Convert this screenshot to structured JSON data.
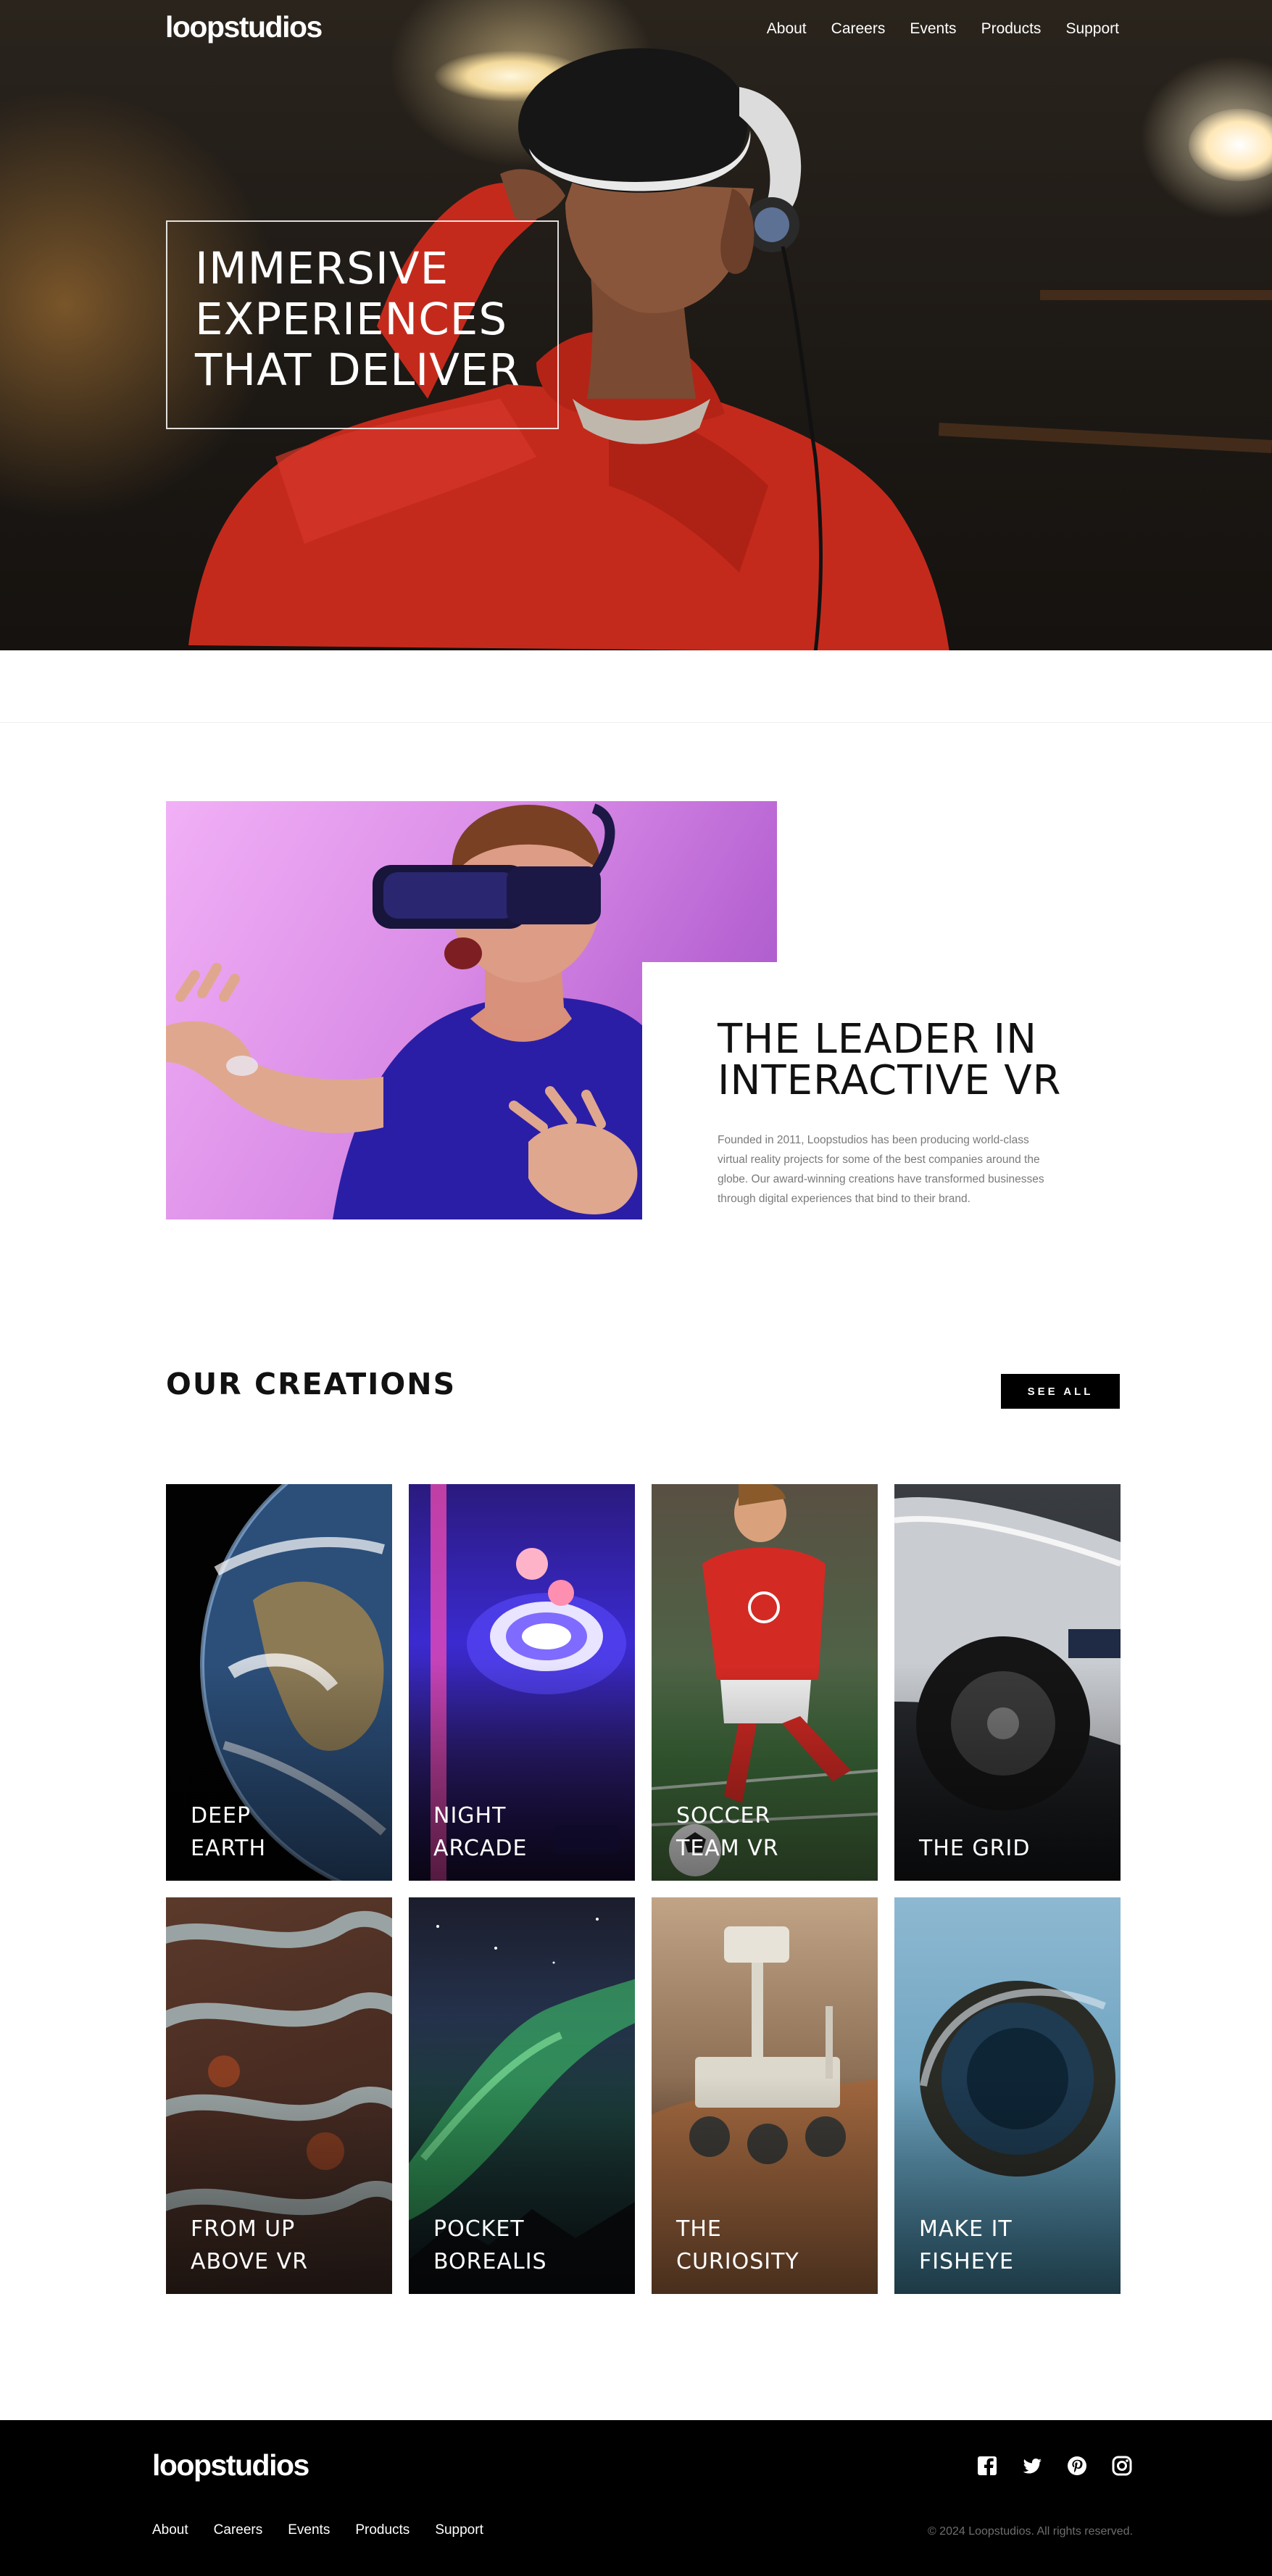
{
  "brand": {
    "logo_text": "loopstudios"
  },
  "header": {
    "nav": [
      "About",
      "Careers",
      "Events",
      "Products",
      "Support"
    ]
  },
  "hero": {
    "title": "IMMERSIVE\nEXPERIENCES\nTHAT DELIVER"
  },
  "leader": {
    "title": "THE LEADER IN\nINTERACTIVE VR",
    "text": "Founded in 2011, Loopstudios has been producing world-class virtual reality projects for some of the best companies around the globe. Our award-winning creations have transformed businesses through digital experiences that bind to their brand."
  },
  "creations": {
    "title": "OUR CREATIONS",
    "see_all_label": "SEE ALL",
    "items": [
      {
        "label": "DEEP\nEARTH"
      },
      {
        "label": "NIGHT\nARCADE"
      },
      {
        "label": "SOCCER\nTEAM VR"
      },
      {
        "label": "THE GRID"
      },
      {
        "label": "FROM UP\nABOVE VR"
      },
      {
        "label": "POCKET\nBOREALIS"
      },
      {
        "label": "THE\nCURIOSITY"
      },
      {
        "label": "MAKE IT\nFISHEYE"
      }
    ]
  },
  "footer": {
    "logo_text": "loopstudios",
    "nav": [
      "About",
      "Careers",
      "Events",
      "Products",
      "Support"
    ],
    "social_icons": [
      "facebook-icon",
      "twitter-icon",
      "pinterest-icon",
      "instagram-icon"
    ],
    "copyright": "© 2024 Loopstudios. All rights reserved."
  },
  "colors": {
    "footer_bg": "#000000",
    "button_bg": "#000000",
    "body_text_muted": "#7a7a7a",
    "hoodie_red": "#c42a1c"
  }
}
